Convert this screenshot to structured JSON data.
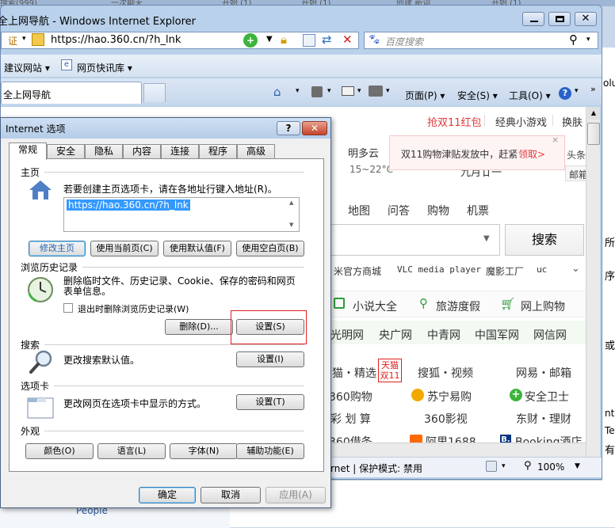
{
  "behind_tabs": [
    "搜索(999)",
    "一次聊天",
    "开始 (1)",
    "开始 (1)",
    "创建 新词",
    "开始 (1)"
  ],
  "ie": {
    "title": "全上网导航 - Windows Internet Explorer",
    "cert": "证",
    "url": "https://hao.360.cn/?h_lnk",
    "search_placeholder": "百度搜索",
    "fav_suggest": "建议网站 ▾",
    "fav_slice": "网页快讯库 ▾",
    "tab_title": "全上网导航",
    "cmd": {
      "page": "页面(P) ▾",
      "safety": "安全(S) ▾",
      "tools": "工具(O) ▾"
    },
    "status": {
      "text": "rnet | 保护模式: 禁用",
      "zoom": "100%"
    }
  },
  "site": {
    "promo": "抢双11红包",
    "games": "经典小游戏",
    "skin": "换肤",
    "weather_city": "明多云",
    "weather_temp": "15~22°C",
    "lunar": "九月廿一",
    "popup_text": "双11购物津贴发放中，赶紧",
    "popup_link": "领取>",
    "side_a": "头条: 阿",
    "side_b": "邮箱",
    "nav": [
      "地图",
      "问答",
      "购物",
      "机票"
    ],
    "search_btn": "搜索",
    "quick": [
      "米官方商城",
      "VLC media player",
      "魔影工厂",
      "uc"
    ],
    "cat": [
      "小说大全",
      "旅游度假",
      "网上购物"
    ],
    "news": [
      "光明网",
      "央广网",
      "中青网",
      "中国军网",
      "网信网"
    ],
    "grid": [
      [
        "猫・精选",
        "搜狐・视频",
        "网易・邮箱"
      ],
      [
        "360购物",
        "苏宁易购",
        "安全卫士"
      ],
      [
        "彩 划 算",
        "360影视",
        "东财・理财"
      ],
      [
        "360借条",
        "阿里1688",
        "Booking酒店"
      ]
    ],
    "tmall": [
      "天猫",
      "双11"
    ],
    "people": "People"
  },
  "dialog": {
    "title": "Internet 选项",
    "tabs": [
      "常规",
      "安全",
      "隐私",
      "内容",
      "连接",
      "程序",
      "高级"
    ],
    "home": {
      "header": "主页",
      "desc": "若要创建主页选项卡，请在各地址行键入地址(R)。",
      "value": "https://hao.360.cn/?h_lnk",
      "buttons": [
        "修改主页",
        "使用当前页(C)",
        "使用默认值(F)",
        "使用空白页(B)"
      ]
    },
    "history": {
      "header": "浏览历史记录",
      "desc": "删除临时文件、历史记录、Cookie、保存的密码和网页表单信息。",
      "checkbox": "退出时删除浏览历史记录(W)",
      "delete": "删除(D)...",
      "settings": "设置(S)"
    },
    "search": {
      "header": "搜索",
      "desc": "更改搜索默认值。",
      "settings": "设置(I)"
    },
    "tabs_sec": {
      "header": "选项卡",
      "desc": "更改网页在选项卡中显示的方式。",
      "settings": "设置(T)"
    },
    "appearance": {
      "header": "外观",
      "buttons": [
        "颜色(O)",
        "语言(L)",
        "字体(N)",
        "辅助功能(E)"
      ]
    },
    "ok": "确定",
    "cancel": "取消",
    "apply": "应用(A)"
  },
  "right_bg": [
    "olu",
    "所",
    "序",
    "或",
    "nte",
    "Te",
    "有"
  ],
  "colors": {
    "accent": "#3399ff",
    "promo_red": "#e4393c",
    "green": "#2e9c3a",
    "highlight": "#e02020"
  }
}
